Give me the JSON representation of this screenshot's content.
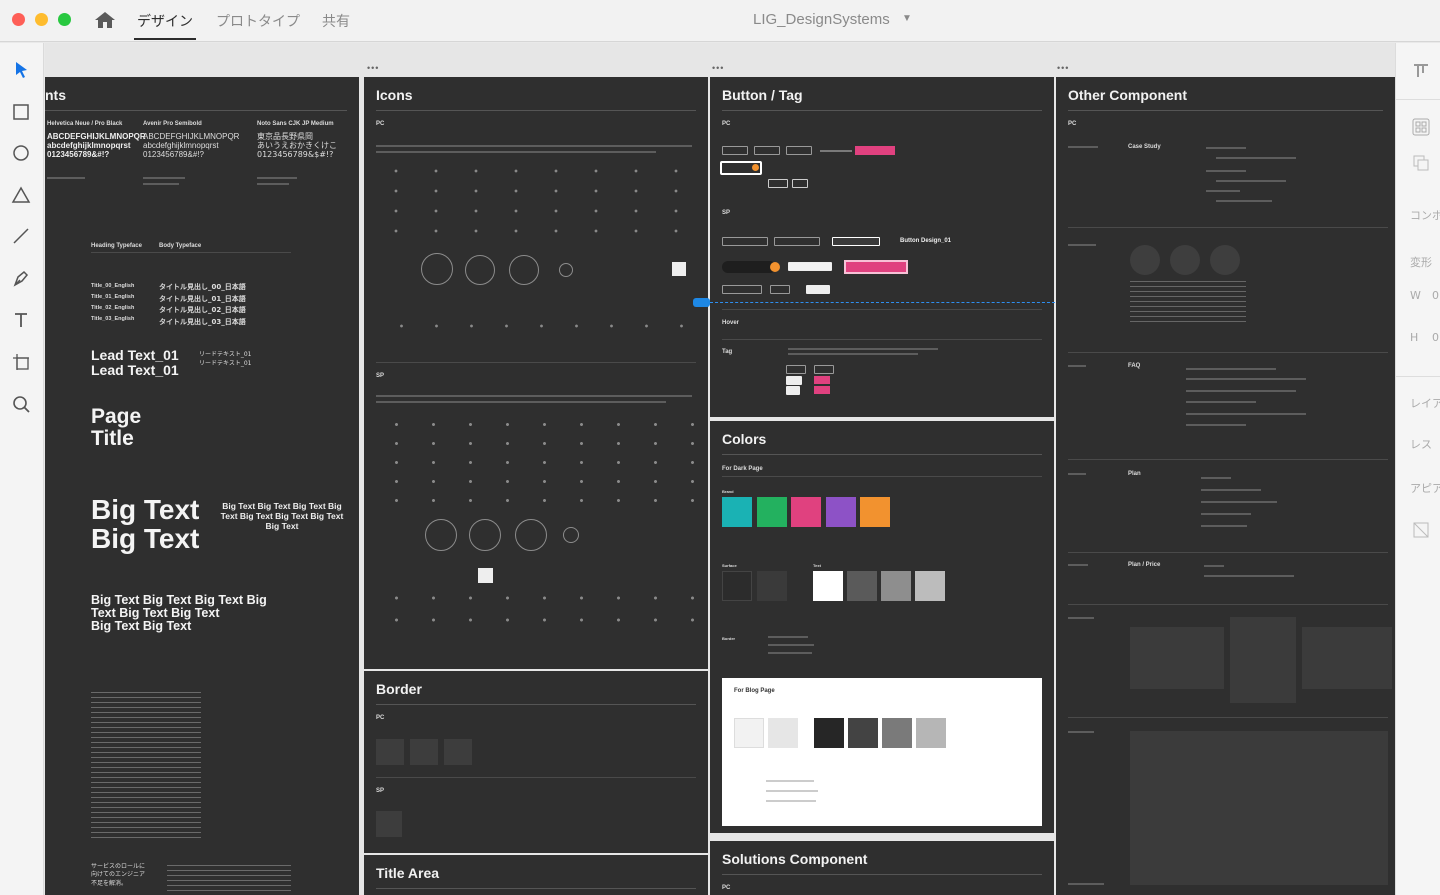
{
  "window": {
    "title": "LIG_DesignSystems",
    "tabs": [
      {
        "label": "デザイン",
        "active": true
      },
      {
        "label": "プロトタイプ",
        "active": false
      },
      {
        "label": "共有",
        "active": false
      }
    ]
  },
  "toolbar": {
    "tools": [
      "select-tool-icon",
      "rectangle-tool-icon",
      "ellipse-tool-icon",
      "polygon-tool-icon",
      "line-tool-icon",
      "pen-tool-icon",
      "text-tool-icon",
      "artboard-tool-icon",
      "zoom-tool-icon"
    ]
  },
  "right_panel": {
    "labels": [
      "コンポ",
      "変形",
      "W",
      "0",
      "H",
      "0",
      "レイア",
      "レス",
      "アピア"
    ]
  },
  "boards": {
    "fonts": {
      "title": "nts",
      "font_names": [
        "Helvetica Neue / Pro Black",
        "Avenir Pro Semibold",
        "Noto Sans CJK JP Medium"
      ],
      "samples": [
        "ABCDEFGHIJKLMNOPQR",
        "abcdefghijklmnopqrst",
        "0123456789&#!?"
      ],
      "sample_jp": [
        "東京品長野県岡",
        "あいうえおかきくけこ",
        "0123456789&$#!?"
      ],
      "name_header": [
        "Heading Typeface",
        "Body Typeface"
      ],
      "title_labels": [
        "Title_00_English",
        "Title_01_English",
        "Title_02_English",
        "Title_03_English"
      ],
      "title_jp": [
        "タイトル見出し_00_日本語",
        "タイトル見出し_01_日本語",
        "タイトル見出し_02_日本語",
        "タイトル見出し_03_日本語"
      ],
      "lead_text": [
        "Lead Text_01",
        "Lead Text_01"
      ],
      "lead_jp": [
        "リードテキスト_01",
        "リードテキスト_01"
      ],
      "page_title": [
        "Page",
        "Title"
      ],
      "big_text": [
        "Big Text",
        "Big Text"
      ],
      "big_text_small": "Big Text Big Text Big Text Big Text Big Text Big Text Big Text Big Text",
      "big_text_mid": [
        "Big Text Big Text Big Text Big",
        "Text Big Text Big Text",
        "Big Text Big Text"
      ],
      "footer_jp": [
        "サービスのロールに",
        "向けてのエンジニア",
        "不足を解消。"
      ]
    },
    "icons": {
      "title": "Icons",
      "sections": [
        "PC",
        "SP"
      ]
    },
    "button_tag": {
      "title": "Button / Tag",
      "sections": [
        "PC",
        "SP",
        "Hover",
        "Tag"
      ],
      "design_label": "Button Design_01"
    },
    "other": {
      "title": "Other Component",
      "sections": [
        "PC",
        "FAQ",
        "Plan",
        "Plan / Price",
        "Case Study"
      ]
    },
    "colors": {
      "title": "Colors",
      "dark_page": "For Dark Page",
      "blog_page": "For Blog Page",
      "swatches_main": [
        "#1ab2b4",
        "#23b15f",
        "#e0417f",
        "#8d52c6",
        "#f2922f"
      ],
      "swatches_dark_surface": [
        "#2c2c2c",
        "#3a3a3a"
      ],
      "swatches_text": [
        "#ffffff",
        "#5a5a5a",
        "#8e8e8e",
        "#bcbcbc"
      ],
      "swatches_blog_surface": [
        "#f2f2f2",
        "#e6e6e6"
      ],
      "swatches_blog_text": [
        "#262626",
        "#434343",
        "#7a7a7a",
        "#b6b6b6"
      ],
      "labels": [
        "Surface",
        "Text",
        "Border",
        "Brand"
      ]
    },
    "border": {
      "title": "Border",
      "sections": [
        "PC",
        "SP"
      ]
    },
    "title_area": {
      "title": "Title Area"
    },
    "solutions": {
      "title": "Solutions Component",
      "sections": [
        "PC"
      ]
    }
  }
}
